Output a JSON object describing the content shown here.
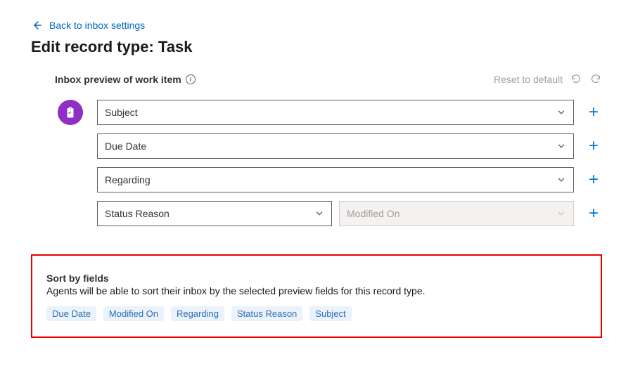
{
  "back_link": "Back to inbox settings",
  "page_title": "Edit record type: Task",
  "preview": {
    "label": "Inbox preview of work item",
    "reset_label": "Reset to default",
    "fields": {
      "row1": "Subject",
      "row2": "Due Date",
      "row3": "Regarding",
      "row4a": "Status Reason",
      "row4b": "Modified On"
    }
  },
  "sort": {
    "title": "Sort by fields",
    "desc": "Agents will be able to sort their inbox by the selected preview fields for this record type.",
    "chips": [
      "Due Date",
      "Modified On",
      "Regarding",
      "Status Reason",
      "Subject"
    ]
  }
}
